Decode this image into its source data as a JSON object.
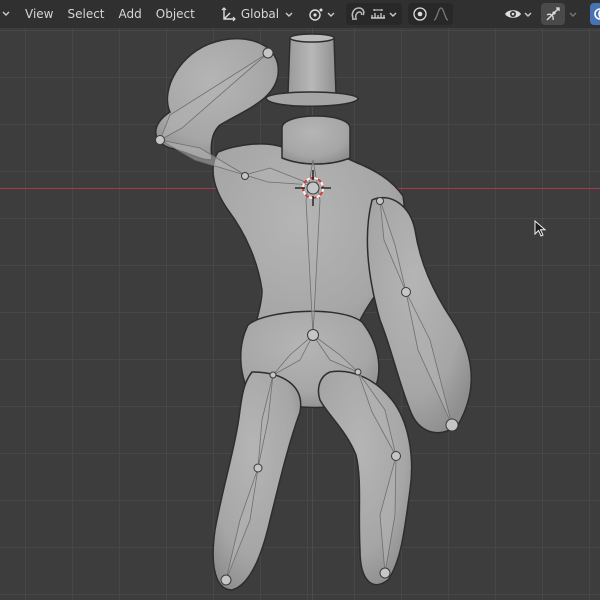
{
  "header": {
    "menus": [
      "View",
      "Select",
      "Add",
      "Object"
    ],
    "orientation": {
      "value": "Global",
      "icon": "transform-orientation-icon"
    },
    "icons": {
      "pivot": "pivot-point-icon",
      "snap": "snap-magnet-icon",
      "snap_target": "snap-increment-icon",
      "proportional": "proportional-editing-icon",
      "falloff": "falloff-curve-icon",
      "visibility": "eye-icon",
      "gizmo": "gizmo-icon",
      "overlays": "overlays-icon"
    },
    "colors": {
      "bar": "#303030",
      "active_blue": "#4772b3"
    }
  },
  "viewport": {
    "colors": {
      "background": "#3d3d3d",
      "grid": "#474747",
      "x_axis": "#a83a45",
      "mesh": "#a9a9a9"
    }
  }
}
